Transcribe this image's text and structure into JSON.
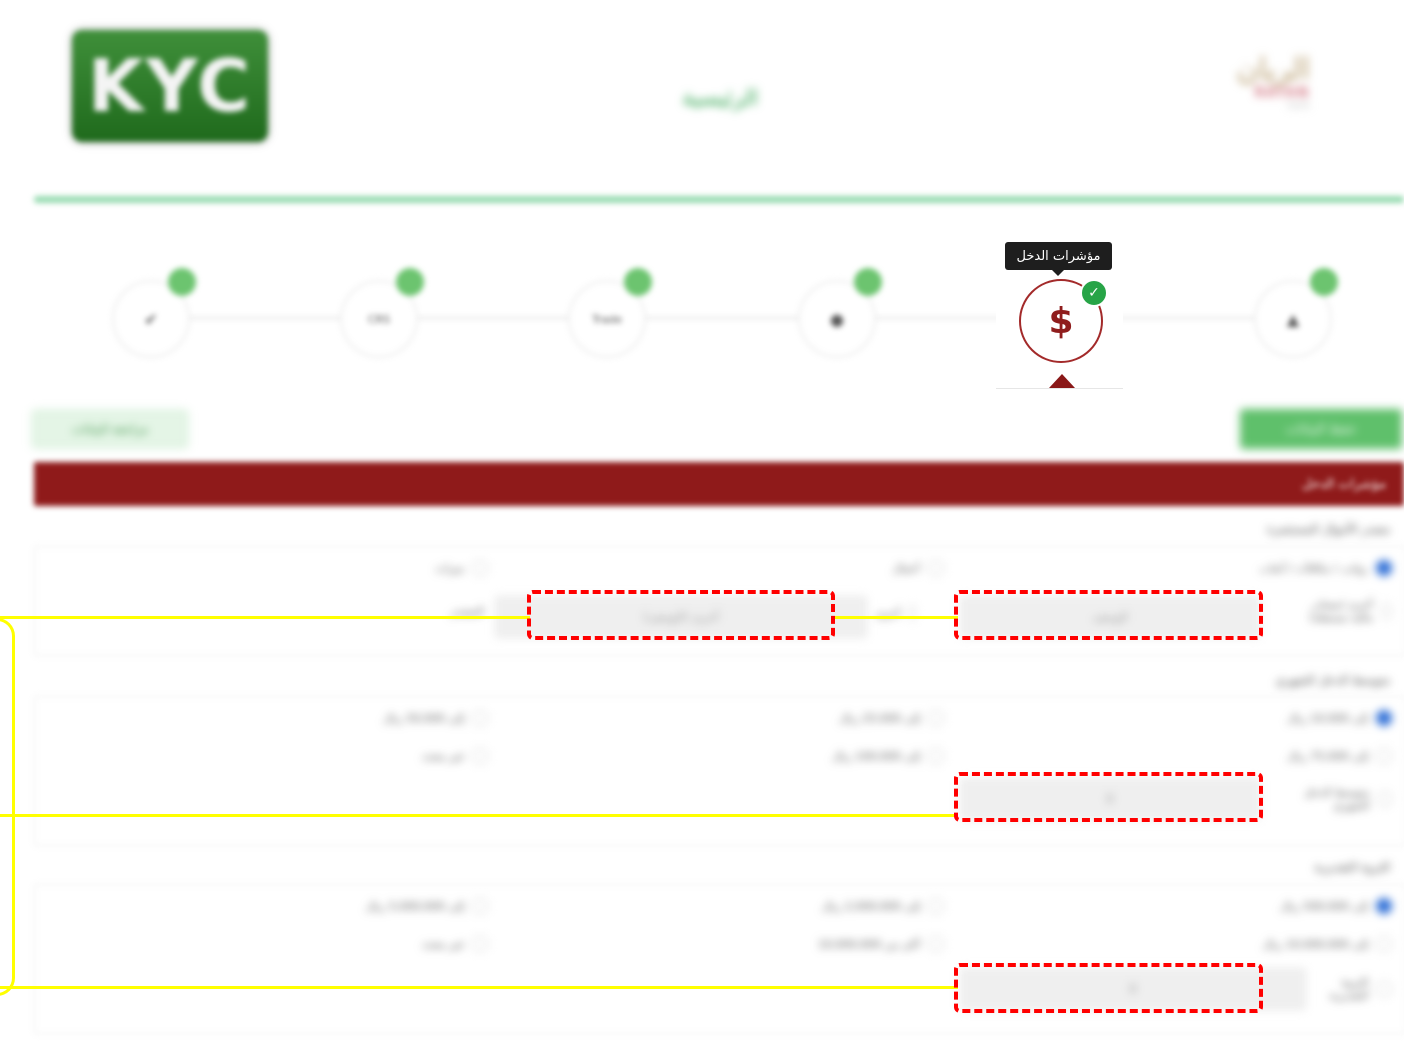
{
  "header": {
    "logo_text": "KYC",
    "title": "الرئيسية",
    "brand_name": "الريان",
    "brand_sub": "RAYAN",
    "brand_tag": "bank"
  },
  "stepper": {
    "steps": [
      {
        "name": "personal",
        "label": ""
      },
      {
        "name": "income",
        "label": "$"
      },
      {
        "name": "globe",
        "label": ""
      },
      {
        "name": "trade",
        "label": "Trade"
      },
      {
        "name": "crs",
        "label": "CRS"
      },
      {
        "name": "done",
        "label": ""
      }
    ],
    "active_tooltip": "مؤشرات الدخل"
  },
  "toolbar": {
    "right_button": "حفظ البيانات",
    "left_button": "مراجعة البيانات"
  },
  "section_title": "مؤشرات الدخل",
  "groups": [
    {
      "title": "مصدر الأموال المستثمرة",
      "options": [
        "رواتب / مكافآت / أتعاب",
        "أعمال",
        "ميراث"
      ],
      "other_label": "أخرى (مصادر مالية مستقلة)",
      "field1_placeholder": "الوصف",
      "field2_placeholder": "أخرى (الوصف)",
      "field2_side_label": "أخرى",
      "extra_label": "المصدر"
    },
    {
      "title": "متوسط الدخل الشهري",
      "options": [
        "إلى 10,000 ريال",
        "إلى 25,000 ريال",
        "إلى 50,000 ريال",
        "إلى 75,000 ريال",
        "إلى 100,000 ريال",
        "غير محدد"
      ],
      "other_label": "متوسط الدخل الشهري",
      "field_value": "0"
    },
    {
      "title": "الثروة التقديرية",
      "options": [
        "إلى 500,000 ريال",
        "إلى 2,000,000 ريال",
        "إلى 5,000,000 ريال",
        "إلى 10,000,000 ريال",
        "أكثر من 10,000,000",
        "غير محدد"
      ],
      "other_label": "الثروة التقديرية",
      "field_value": "0"
    }
  ],
  "colors": {
    "accent_green": "#5fc06b",
    "section_red": "#8f1a1a",
    "annotation_red": "#ff0000",
    "annotation_yellow": "#ffff00"
  }
}
